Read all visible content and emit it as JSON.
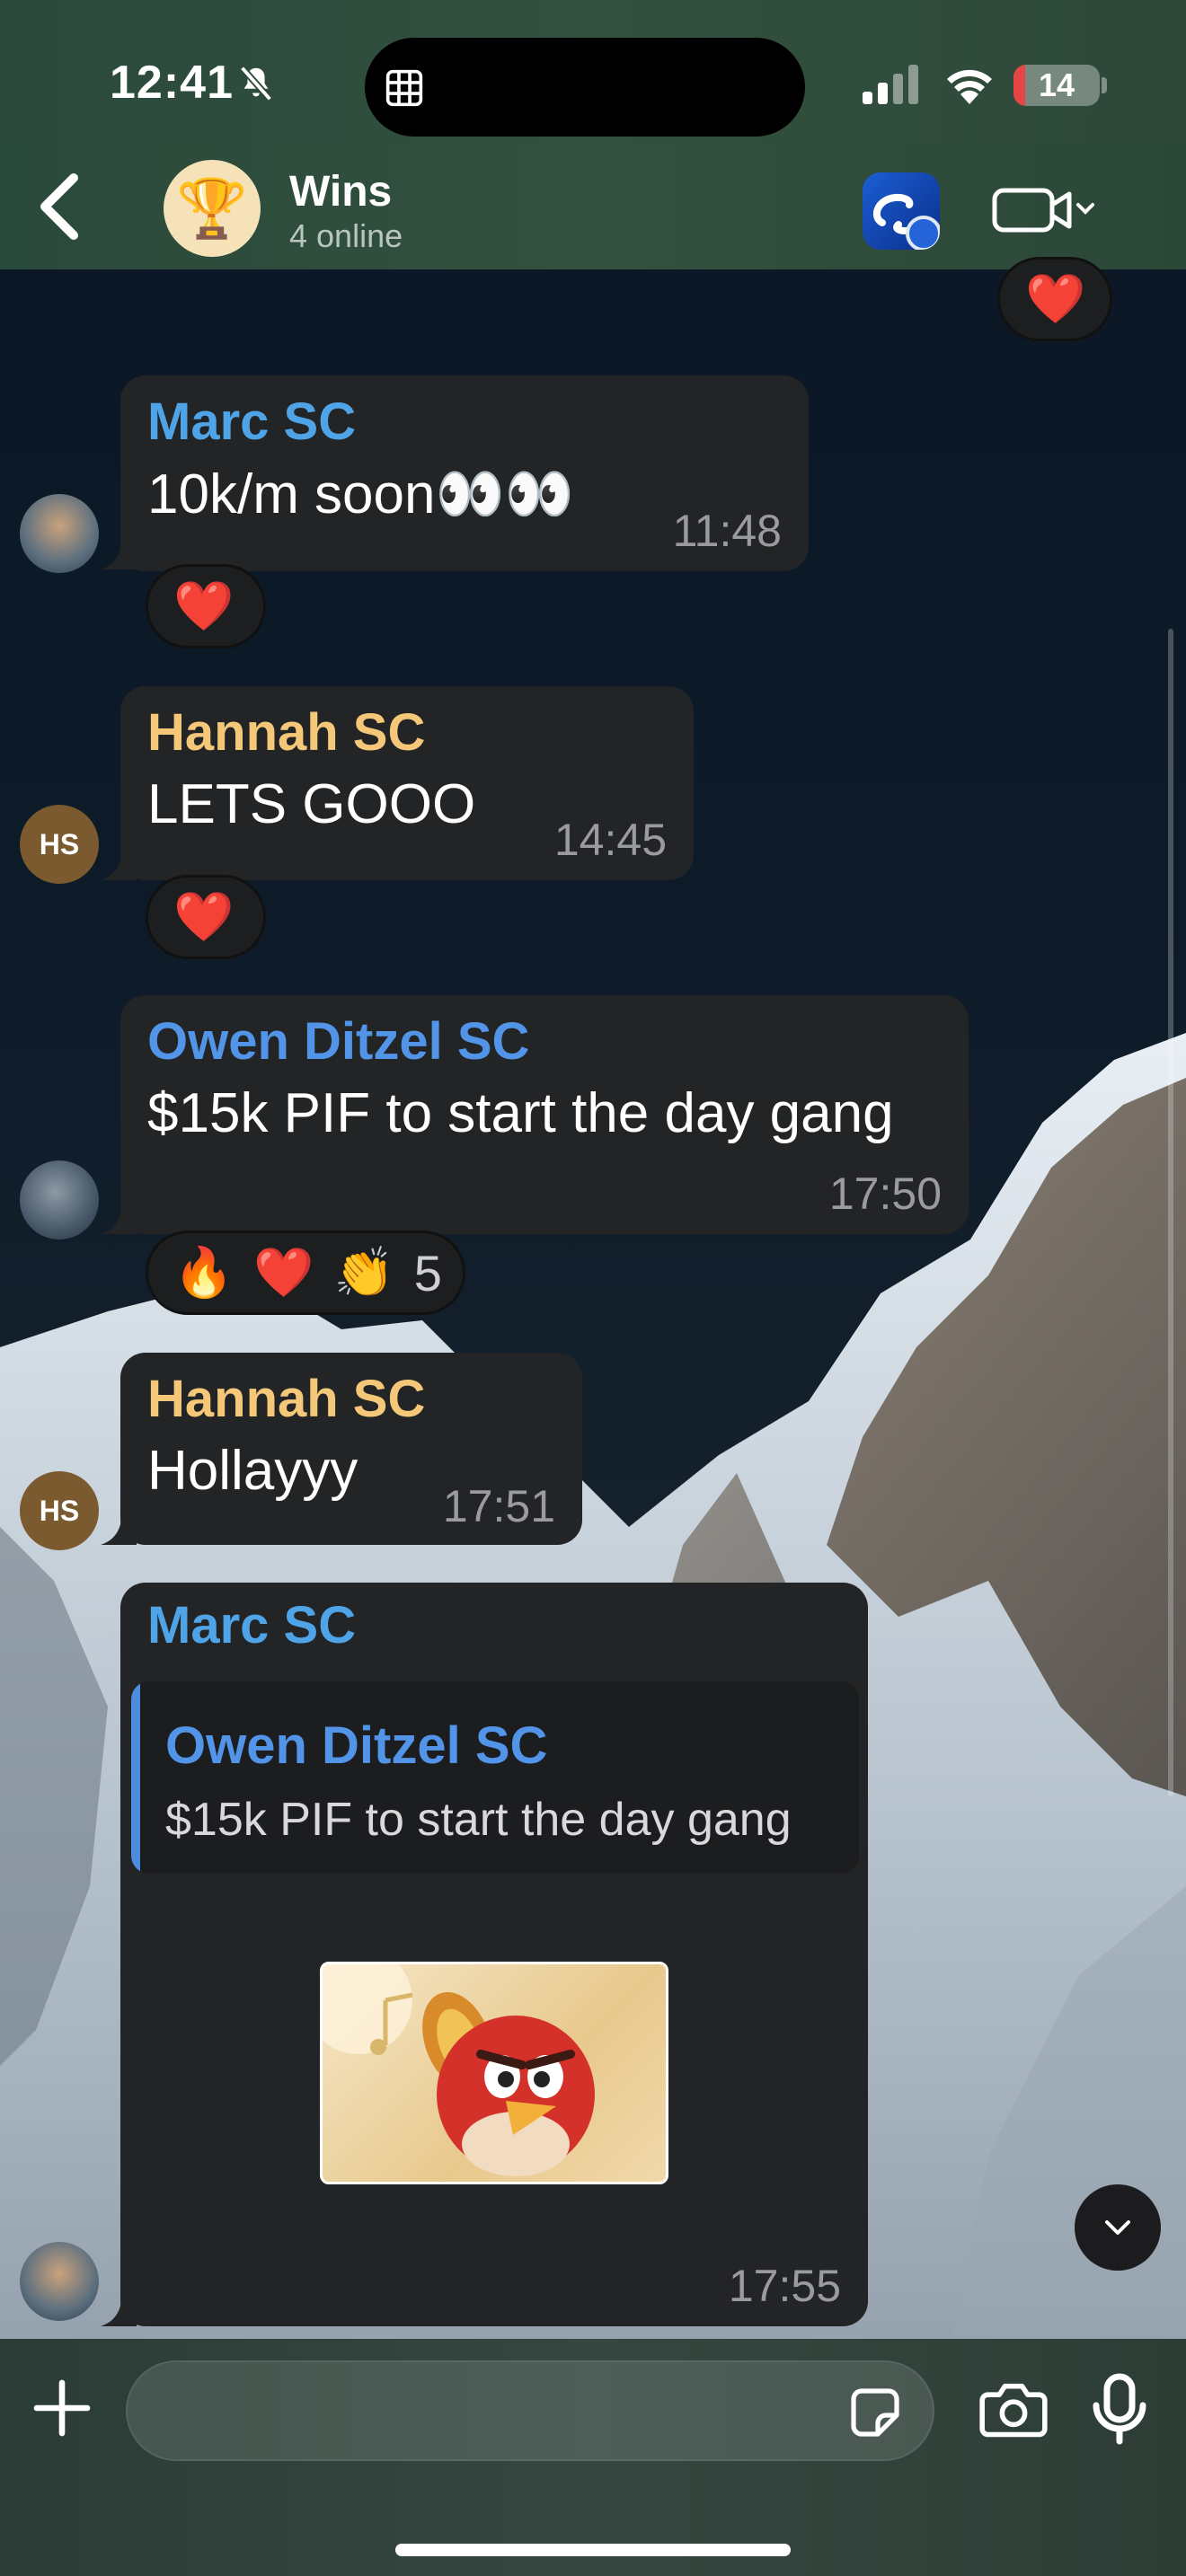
{
  "status_bar": {
    "time": "12:41",
    "battery": "14",
    "battery_level": 0.14
  },
  "header": {
    "group_name": "Wins",
    "subtitle": "4 online",
    "group_emoji": "🏆"
  },
  "colors": {
    "marc": "#4fa4e8",
    "hannah": "#f5c879",
    "owen": "#5294e8",
    "bubble": "#232425"
  },
  "messages": [
    {
      "sender": "Marc SC",
      "text": "10k/m soon👀👀",
      "time": "11:48",
      "reactions": [
        "❤️"
      ]
    },
    {
      "sender": "Hannah SC",
      "avatar_initials": "HS",
      "text": "LETS GOOO",
      "time": "14:45",
      "reactions": [
        "❤️"
      ]
    },
    {
      "sender": "Owen Ditzel SC",
      "text": "$15k PIF to start the day gang",
      "time": "17:50",
      "reactions": [
        "🔥",
        "❤️",
        "👏"
      ],
      "reaction_count": "5"
    },
    {
      "sender": "Hannah SC",
      "avatar_initials": "HS",
      "text": "Hollayyy",
      "time": "17:51"
    },
    {
      "sender": "Marc SC",
      "reply_to": {
        "sender": "Owen Ditzel SC",
        "text": "$15k PIF to start the day gang"
      },
      "time": "17:55",
      "sticker": "red-bird-sticker"
    }
  ],
  "top_reaction": "❤️",
  "input": {
    "placeholder": "",
    "value": ""
  },
  "icons": [
    "bell-slash-icon",
    "grid-icon",
    "signal-icon",
    "wifi-icon",
    "back-icon",
    "video-call-icon",
    "plus-icon",
    "sticker-icon",
    "camera-icon",
    "microphone-icon",
    "chevron-down-icon"
  ]
}
